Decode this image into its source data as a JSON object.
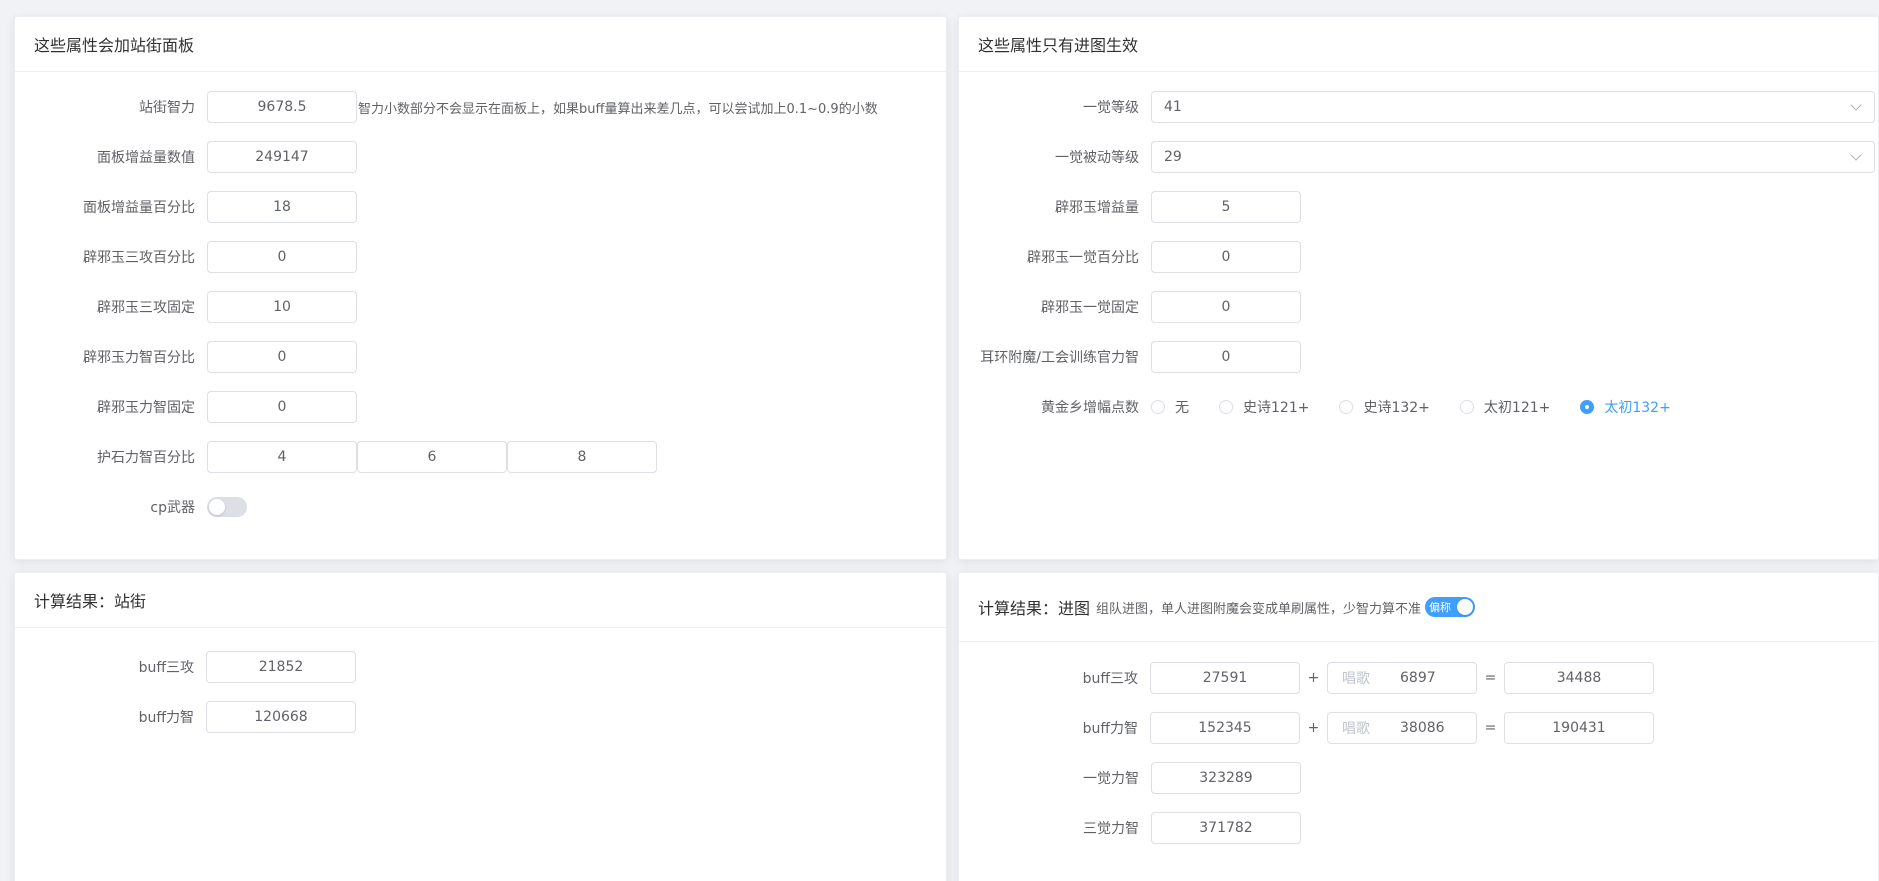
{
  "panel_top_left": {
    "title": "这些属性会加站街面板",
    "fields": [
      {
        "label": "站街智力",
        "value": "9678.5"
      },
      {
        "label": "面板增益量数值",
        "value": "249147"
      },
      {
        "label": "面板增益量百分比",
        "value": "18"
      },
      {
        "label": "辟邪玉三攻百分比",
        "value": "0"
      },
      {
        "label": "辟邪玉三攻固定",
        "value": "10"
      },
      {
        "label": "辟邪玉力智百分比",
        "value": "0"
      },
      {
        "label": "辟邪玉力智固定",
        "value": "0"
      }
    ],
    "hint": "智力小数部分不会显示在面板上，如果buff量算出来差几点，可以尝试加上0.1~0.9的小数",
    "stone": {
      "label": "护石力智百分比",
      "values": [
        "4",
        "6",
        "8"
      ]
    },
    "cp_weapon": {
      "label": "cp武器",
      "on": false
    }
  },
  "panel_top_right": {
    "title": "这些属性只有进图生效",
    "awake_level": {
      "label": "一觉等级",
      "value": "41"
    },
    "awake_passive_level": {
      "label": "一觉被动等级",
      "value": "29"
    },
    "fields": [
      {
        "label": "辟邪玉增益量",
        "value": "5"
      },
      {
        "label": "辟邪玉一觉百分比",
        "value": "0"
      },
      {
        "label": "辟邪玉一觉固定",
        "value": "0"
      },
      {
        "label": "耳环附魔/工会训练官力智",
        "value": "0"
      }
    ],
    "gold_village": {
      "label": "黄金乡增幅点数",
      "options": [
        "无",
        "史诗121+",
        "史诗132+",
        "太初121+",
        "太初132+"
      ],
      "selected": "太初132+"
    }
  },
  "panel_bottom_left": {
    "title": "计算结果：站街",
    "results": [
      {
        "label": "buff三攻",
        "value": "21852"
      },
      {
        "label": "buff力智",
        "value": "120668"
      }
    ]
  },
  "panel_bottom_right": {
    "title": "计算结果：进图",
    "note": "组队进图，单人进图附魔会变成单刷属性，少智力算不准",
    "toggle": {
      "label": "偏称",
      "on": true
    },
    "sums": [
      {
        "label": "buff三攻",
        "base": "27591",
        "plus": "+",
        "prefix": "唱歌",
        "song": "6897",
        "equals": "=",
        "total": "34488"
      },
      {
        "label": "buff力智",
        "base": "152345",
        "plus": "+",
        "prefix": "唱歌",
        "song": "38086",
        "equals": "=",
        "total": "190431"
      }
    ],
    "results": [
      {
        "label": "一觉力智",
        "value": "323289"
      },
      {
        "label": "三觉力智",
        "value": "371782"
      }
    ]
  },
  "colors": {
    "accent": "#409eff",
    "border": "#dcdfe6",
    "text": "#606266",
    "background": "#f0f2f5"
  }
}
